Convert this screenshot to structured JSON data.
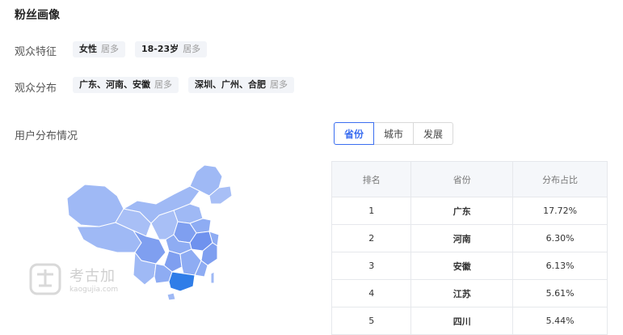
{
  "title": "粉丝画像",
  "features": {
    "label": "观众特征",
    "tags": [
      {
        "value": "女性",
        "note": "居多"
      },
      {
        "value": "18-23岁",
        "note": "居多"
      }
    ]
  },
  "distribution": {
    "label": "观众分布",
    "tags": [
      {
        "value": "广东、河南、安徽",
        "note": "居多"
      },
      {
        "value": "深圳、广州、合肥",
        "note": "居多"
      }
    ]
  },
  "user_distribution_label": "用户分布情况",
  "tabs": [
    {
      "label": "省份",
      "active": true
    },
    {
      "label": "城市",
      "active": false
    },
    {
      "label": "发展",
      "active": false
    }
  ],
  "table": {
    "headers": [
      "排名",
      "省份",
      "分布占比"
    ],
    "rows": [
      {
        "rank": "1",
        "province": "广东",
        "share": "17.72%"
      },
      {
        "rank": "2",
        "province": "河南",
        "share": "6.30%"
      },
      {
        "rank": "3",
        "province": "安徽",
        "share": "6.13%"
      },
      {
        "rank": "4",
        "province": "江苏",
        "share": "5.61%"
      },
      {
        "rank": "5",
        "province": "四川",
        "share": "5.44%"
      }
    ]
  },
  "watermark": {
    "text": "考古加",
    "sub": "kaogujia.com"
  },
  "colors": {
    "accent": "#3b6ef0",
    "map_base": "#9fb9f5",
    "map_mid": "#7f9ff0",
    "map_dark": "#5b7fe8",
    "map_top": "#2f7de8"
  },
  "icons": {
    "map": "china-map-icon",
    "logo": "kaogujia-logo-icon"
  }
}
